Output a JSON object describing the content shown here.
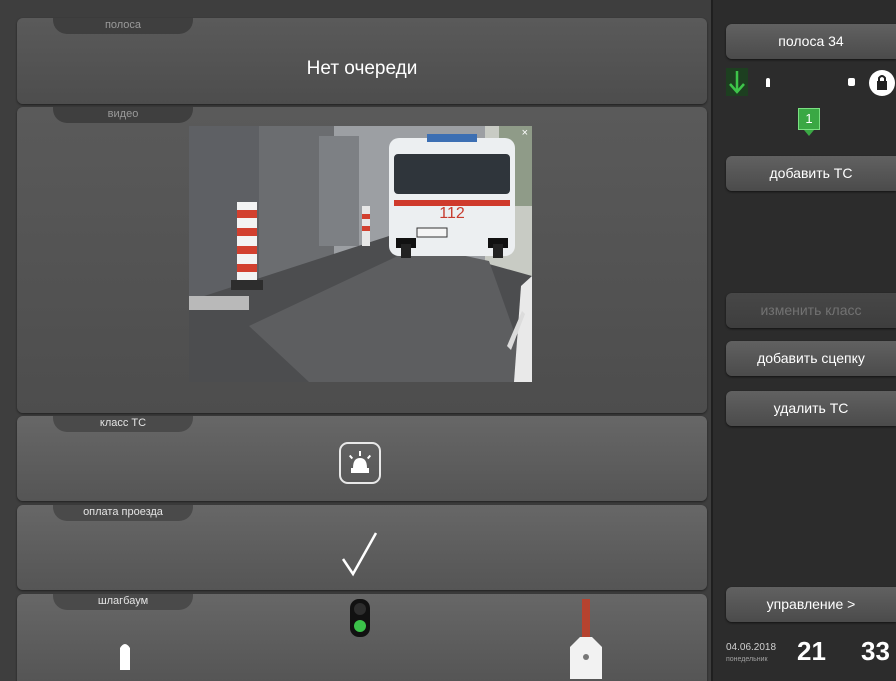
{
  "lane_panel": {
    "tab": "полоса",
    "status": "Нет очереди"
  },
  "video_panel": {
    "tab": "видео",
    "close": "×",
    "plate": "112"
  },
  "class_panel": {
    "tab": "класс ТС",
    "icon": "emergency-beacon-icon"
  },
  "payment_panel": {
    "tab": "оплата проезда",
    "icon": "checkmark-icon"
  },
  "barrier_panel": {
    "tab": "шлагбаум",
    "traffic_light": "green",
    "left_barrier_state": "open",
    "right_barrier_state": "closed"
  },
  "sidebar": {
    "lane_button": "полоса 34",
    "queue_badge": "1",
    "add_vehicle": "добавить ТС",
    "change_class": "изменить класс",
    "add_trailer": "добавить сцепку",
    "delete_vehicle": "удалить ТС",
    "control": "управление >"
  },
  "footer": {
    "date": "04.06.2018",
    "weekday": "понедельник",
    "hours": "21",
    "minutes": "33"
  },
  "colors": {
    "accent_green": "#34a853",
    "barrier_red": "#b5432f"
  }
}
